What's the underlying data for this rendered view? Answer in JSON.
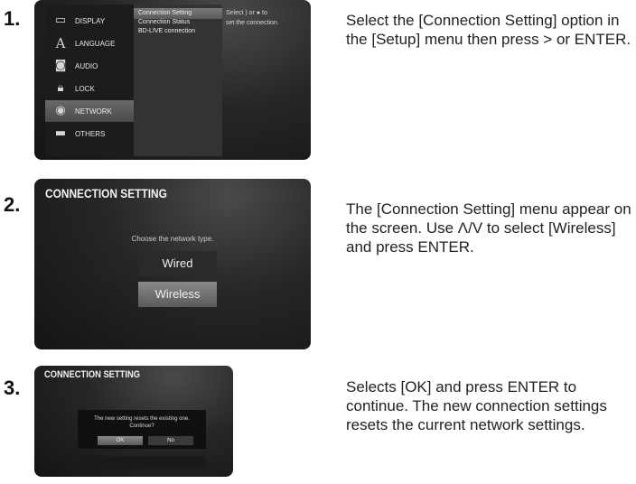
{
  "steps": [
    {
      "number": "1.",
      "description": "Select the [Connection Setting] option in the [Setup] menu then press > or ENTER.",
      "screen": {
        "menu_items": [
          {
            "label": "DISPLAY",
            "icon": "display-icon",
            "selected": false
          },
          {
            "label": "LANGUAGE",
            "icon": "language-icon",
            "selected": false
          },
          {
            "label": "AUDIO",
            "icon": "audio-icon",
            "selected": false
          },
          {
            "label": "LOCK",
            "icon": "lock-icon",
            "selected": false
          },
          {
            "label": "NETWORK",
            "icon": "network-icon",
            "selected": true
          },
          {
            "label": "OTHERS",
            "icon": "others-icon",
            "selected": false
          }
        ],
        "submenu_items": [
          "Connection Setting",
          "Connection Status",
          "BD-LIVE connection"
        ],
        "selected_submenu": "Connection Setting",
        "help_line1": "Select ) or ● to",
        "help_line2": "set the connection."
      }
    },
    {
      "number": "2.",
      "description": "The [Connection Setting] menu appear on the screen. Use Λ/V to select [Wireless] and press ENTER.",
      "screen": {
        "title": "CONNECTION SETTING",
        "prompt": "Choose the network type.",
        "options": [
          "Wired",
          "Wireless"
        ],
        "selected_option": "Wireless"
      }
    },
    {
      "number": "3.",
      "description": "Selects [OK] and press ENTER to continue. The new connection settings resets the current network settings.",
      "screen": {
        "title": "CONNECTION SETTING",
        "dialog_line1": "The new setting resets the existing one.",
        "dialog_line2": "Continue?",
        "buttons": [
          "OK",
          "No"
        ],
        "selected_button": "OK"
      }
    }
  ]
}
